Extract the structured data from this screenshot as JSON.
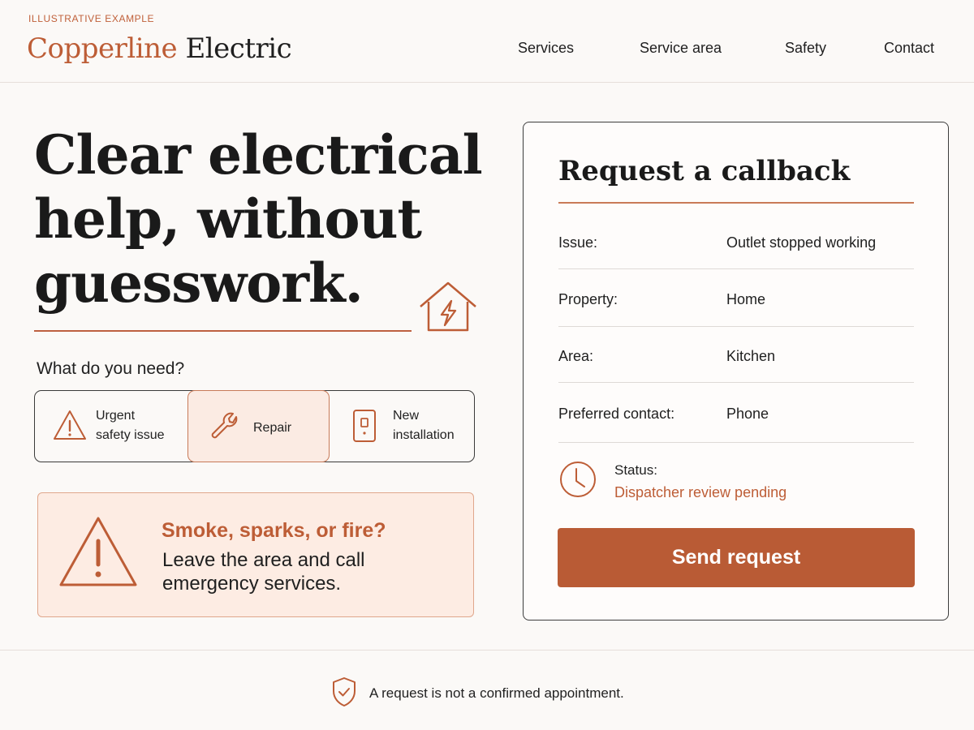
{
  "header": {
    "eyebrow": "ILLUSTRATIVE EXAMPLE",
    "brand_part1": "Copperline",
    "brand_part2": "Electric",
    "nav": [
      "Services",
      "Service area",
      "Safety",
      "Contact"
    ]
  },
  "hero": {
    "title": "Clear electrical help, without guesswork.",
    "icon": "house-bolt-icon"
  },
  "need": {
    "label": "What do you need?",
    "options": [
      {
        "line1": "Urgent",
        "line2": "safety issue",
        "icon": "warning-icon",
        "selected": false
      },
      {
        "line1": "Repair",
        "icon": "wrench-icon",
        "selected": true
      },
      {
        "line1": "New",
        "line2": "installation",
        "icon": "outlet-icon",
        "selected": false
      }
    ]
  },
  "alert": {
    "title": "Smoke, sparks, or fire?",
    "body": "Leave the area and call emergency services.",
    "icon": "warning-icon"
  },
  "callback": {
    "title": "Request a callback",
    "fields": [
      {
        "label": "Issue:",
        "value": "Outlet stopped working"
      },
      {
        "label": "Property:",
        "value": "Home"
      },
      {
        "label": "Area:",
        "value": "Kitchen"
      },
      {
        "label": "Preferred contact:",
        "value": "Phone"
      }
    ],
    "status_label": "Status:",
    "status_value": "Dispatcher review pending",
    "status_icon": "clock-icon",
    "submit_label": "Send request"
  },
  "footer": {
    "note": "A request is not a confirmed appointment.",
    "icon": "shield-check-icon"
  },
  "colors": {
    "accent": "#b95b35",
    "background": "#fbf9f7",
    "alert_bg": "#fdece3",
    "text": "#1f1f1f"
  }
}
